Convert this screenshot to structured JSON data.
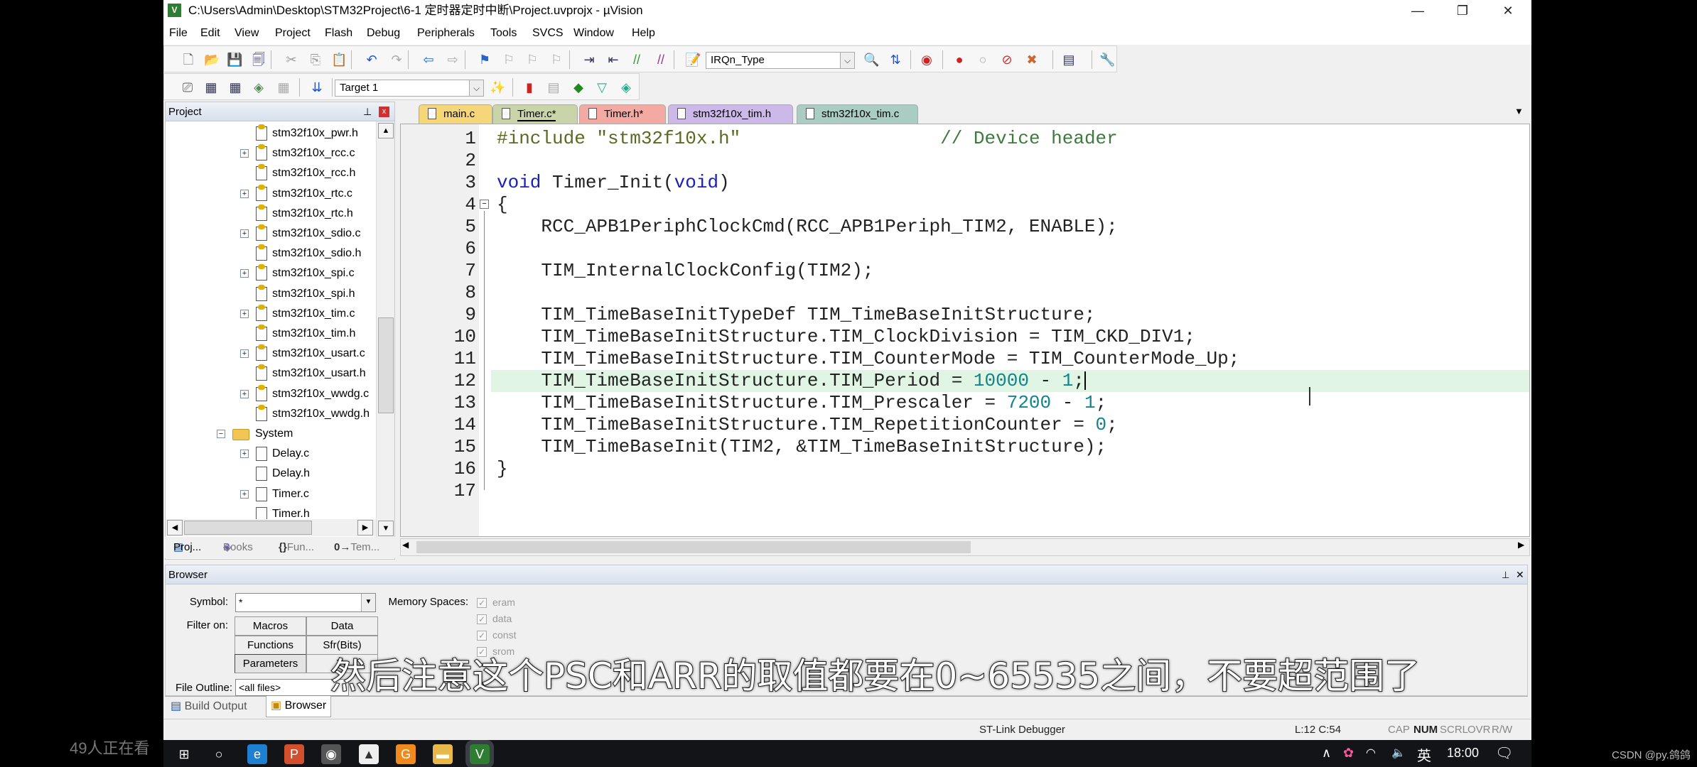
{
  "window": {
    "title": "C:\\Users\\Admin\\Desktop\\STM32Project\\6-1 定时器定时中断\\Project.uvprojx - µVision",
    "app_icon": "keil-uvision-icon",
    "controls": {
      "minimize": "—",
      "restore": "❐",
      "close": "✕"
    }
  },
  "menu": [
    "File",
    "Edit",
    "View",
    "Project",
    "Flash",
    "Debug",
    "Peripherals",
    "Tools",
    "SVCS",
    "Window",
    "Help"
  ],
  "toolbar1": {
    "icons": [
      {
        "name": "new-file-icon",
        "glyph": "🗋",
        "color": "#666"
      },
      {
        "name": "open-file-icon",
        "glyph": "📂",
        "color": "#c80"
      },
      {
        "name": "save-icon",
        "glyph": "💾",
        "color": "#336"
      },
      {
        "name": "save-all-icon",
        "glyph": "🗐",
        "color": "#336"
      },
      {
        "name": "cut-icon",
        "glyph": "✂",
        "color": "#999"
      },
      {
        "name": "copy-icon",
        "glyph": "⎘",
        "color": "#999"
      },
      {
        "name": "paste-icon",
        "glyph": "📋",
        "color": "#a70"
      },
      {
        "name": "undo-icon",
        "glyph": "↶",
        "color": "#2255cc"
      },
      {
        "name": "redo-icon",
        "glyph": "↷",
        "color": "#aaa"
      },
      {
        "name": "navigate-back-icon",
        "glyph": "⇦",
        "color": "#2266cc"
      },
      {
        "name": "navigate-forward-icon",
        "glyph": "⇨",
        "color": "#aaa"
      },
      {
        "name": "bookmark-icon",
        "glyph": "⚑",
        "color": "#2266cc"
      },
      {
        "name": "prev-bookmark-icon",
        "glyph": "⚐",
        "color": "#aaa"
      },
      {
        "name": "next-bookmark-icon",
        "glyph": "⚐",
        "color": "#aaa"
      },
      {
        "name": "clear-bookmarks-icon",
        "glyph": "⚐",
        "color": "#aaa"
      },
      {
        "name": "indent-icon",
        "glyph": "⇥",
        "color": "#335"
      },
      {
        "name": "unindent-icon",
        "glyph": "⇤",
        "color": "#335"
      },
      {
        "name": "comment-icon",
        "glyph": "//",
        "color": "#393"
      },
      {
        "name": "uncomment-icon",
        "glyph": "//",
        "color": "#939"
      },
      {
        "name": "find-in-files-icon",
        "glyph": "📝",
        "color": "#a70"
      }
    ],
    "find_combo": "IRQn_Type",
    "icons2": [
      {
        "name": "find-icon",
        "glyph": "🔍",
        "color": "#336"
      },
      {
        "name": "incremental-find-icon",
        "glyph": "⇅",
        "color": "#2255cc"
      },
      {
        "name": "debug-session-icon",
        "glyph": "◉",
        "color": "#c22"
      },
      {
        "name": "breakpoint-icon",
        "glyph": "●",
        "color": "#c22"
      },
      {
        "name": "disable-breakpoint-icon",
        "glyph": "○",
        "color": "#aaa"
      },
      {
        "name": "disable-all-breakpoints-icon",
        "glyph": "⊘",
        "color": "#c33"
      },
      {
        "name": "kill-breakpoints-icon",
        "glyph": "✖",
        "color": "#c63"
      },
      {
        "name": "window-layout-icon",
        "glyph": "▤",
        "color": "#336"
      },
      {
        "name": "configure-icon",
        "glyph": "🔧",
        "color": "#556"
      }
    ]
  },
  "toolbar2": {
    "icons": [
      {
        "name": "translate-icon",
        "glyph": "⎚",
        "color": "#555"
      },
      {
        "name": "build-icon",
        "glyph": "▦",
        "color": "#335"
      },
      {
        "name": "rebuild-icon",
        "glyph": "▦",
        "color": "#335"
      },
      {
        "name": "batch-build-icon",
        "glyph": "◈",
        "color": "#585"
      },
      {
        "name": "stop-build-icon",
        "glyph": "▦",
        "color": "#aaa"
      },
      {
        "name": "download-load-icon",
        "glyph": "⇊",
        "color": "#2255cc"
      }
    ],
    "target": "Target 1",
    "icons2": [
      {
        "name": "target-options-icon",
        "glyph": "✨",
        "color": "#335"
      },
      {
        "name": "file-extensions-icon",
        "glyph": "▮",
        "color": "#c22"
      },
      {
        "name": "manage-components-icon",
        "glyph": "▤",
        "color": "#aaa"
      },
      {
        "name": "select-pack-icon",
        "glyph": "◆",
        "color": "#282"
      },
      {
        "name": "pack-installer-icon",
        "glyph": "▽",
        "color": "#2a8"
      },
      {
        "name": "run-time-env-icon",
        "glyph": "◈",
        "color": "#2a8"
      }
    ]
  },
  "project": {
    "title": "Project",
    "pin": "⊥",
    "close": "x",
    "tree": [
      {
        "label": "stm32f10x_pwr.h",
        "expand": false,
        "icon": "key-file-icon"
      },
      {
        "label": "stm32f10x_rcc.c",
        "expand": true,
        "icon": "key-file-icon"
      },
      {
        "label": "stm32f10x_rcc.h",
        "expand": false,
        "icon": "key-file-icon"
      },
      {
        "label": "stm32f10x_rtc.c",
        "expand": true,
        "icon": "key-file-icon"
      },
      {
        "label": "stm32f10x_rtc.h",
        "expand": false,
        "icon": "key-file-icon"
      },
      {
        "label": "stm32f10x_sdio.c",
        "expand": true,
        "icon": "key-file-icon"
      },
      {
        "label": "stm32f10x_sdio.h",
        "expand": false,
        "icon": "key-file-icon"
      },
      {
        "label": "stm32f10x_spi.c",
        "expand": true,
        "icon": "key-file-icon"
      },
      {
        "label": "stm32f10x_spi.h",
        "expand": false,
        "icon": "key-file-icon"
      },
      {
        "label": "stm32f10x_tim.c",
        "expand": true,
        "icon": "key-file-icon"
      },
      {
        "label": "stm32f10x_tim.h",
        "expand": false,
        "icon": "key-file-icon"
      },
      {
        "label": "stm32f10x_usart.c",
        "expand": true,
        "icon": "key-file-icon"
      },
      {
        "label": "stm32f10x_usart.h",
        "expand": false,
        "icon": "key-file-icon"
      },
      {
        "label": "stm32f10x_wwdg.c",
        "expand": true,
        "icon": "key-file-icon"
      },
      {
        "label": "stm32f10x_wwdg.h",
        "expand": false,
        "icon": "key-file-icon"
      },
      {
        "label": "System",
        "expand": "collapse",
        "icon": "folder-icon"
      },
      {
        "label": "Delay.c",
        "expand": true,
        "icon": "file-icon"
      },
      {
        "label": "Delay.h",
        "expand": false,
        "icon": "file-icon"
      },
      {
        "label": "Timer.c",
        "expand": true,
        "icon": "file-icon"
      },
      {
        "label": "Timer.h",
        "expand": false,
        "icon": "file-icon"
      }
    ],
    "tabs": [
      "Proj...",
      "Books",
      "Fun...",
      "Tem..."
    ]
  },
  "editor": {
    "tabs": [
      {
        "label": "main.c",
        "color": "#f5d77a"
      },
      {
        "label": "Timer.c*",
        "color": "#c9d5a9",
        "active": true
      },
      {
        "label": "Timer.h*",
        "color": "#f2aaa2"
      },
      {
        "label": "stm32f10x_tim.h",
        "color": "#cdb8ea"
      },
      {
        "label": "stm32f10x_tim.c",
        "color": "#a9cdc2"
      }
    ],
    "tab_menu": "▼",
    "tab_close": "X",
    "current_line": 12,
    "lines": [
      [
        [
          "#include \"stm32f10x.h\"",
          "pp"
        ],
        [
          "                  ",
          ""
        ],
        [
          "// Device header",
          "cm"
        ]
      ],
      [],
      [
        [
          "void",
          "kw"
        ],
        [
          " Timer_Init(",
          ""
        ],
        [
          "void",
          "kw"
        ],
        [
          ")",
          ""
        ]
      ],
      [
        [
          "{",
          ""
        ]
      ],
      [
        [
          "    RCC_APB1PeriphClockCmd(RCC_APB1Periph_TIM2, ENABLE);",
          ""
        ]
      ],
      [],
      [
        [
          "    TIM_InternalClockConfig(TIM2);",
          ""
        ]
      ],
      [],
      [
        [
          "    TIM_TimeBaseInitTypeDef TIM_TimeBaseInitStructure;",
          ""
        ]
      ],
      [
        [
          "    TIM_TimeBaseInitStructure.TIM_ClockDivision = TIM_CKD_DIV1;",
          ""
        ]
      ],
      [
        [
          "    TIM_TimeBaseInitStructure.TIM_CounterMode = TIM_CounterMode_Up;",
          ""
        ]
      ],
      [
        [
          "    TIM_TimeBaseInitStructure.TIM_Period = ",
          ""
        ],
        [
          "10000",
          "num"
        ],
        [
          " - ",
          ""
        ],
        [
          "1",
          "num"
        ],
        [
          ";",
          ""
        ]
      ],
      [
        [
          "    TIM_TimeBaseInitStructure.TIM_Prescaler = ",
          ""
        ],
        [
          "7200",
          "num"
        ],
        [
          " - ",
          ""
        ],
        [
          "1",
          "num"
        ],
        [
          ";",
          ""
        ]
      ],
      [
        [
          "    TIM_TimeBaseInitStructure.TIM_RepetitionCounter = ",
          ""
        ],
        [
          "0",
          "num"
        ],
        [
          ";",
          ""
        ]
      ],
      [
        [
          "    TIM_TimeBaseInit(TIM2, &TIM_TimeBaseInitStructure);",
          ""
        ]
      ],
      [
        [
          "}",
          ""
        ]
      ],
      []
    ]
  },
  "browser": {
    "title": "Browser",
    "symbol_label": "Symbol:",
    "symbol_value": "*",
    "memory_label": "Memory Spaces:",
    "memory_spaces": [
      "eram",
      "data",
      "const",
      "srom"
    ],
    "filter_label": "Filter on:",
    "filters": [
      "Macros",
      "Data",
      "Functions",
      "Sfr(Bits)",
      "Parameters",
      "Ty"
    ],
    "file_outline_label": "File Outline:",
    "file_outline_value": "<all files>"
  },
  "bottom_tabs": [
    "Build Output",
    "Browser"
  ],
  "status": {
    "debugger": "ST-Link Debugger",
    "position": "L:12 C:54",
    "cap": "CAP",
    "num": "NUM",
    "scrl": "SCRL",
    "ovr": "OVR",
    "rw": "R/W"
  },
  "taskbar": {
    "apps": [
      {
        "name": "start-icon",
        "glyph": "⊞",
        "bg": "transparent"
      },
      {
        "name": "cortana-icon",
        "glyph": "○",
        "bg": "transparent"
      },
      {
        "name": "edge-icon",
        "glyph": "e",
        "bg": "#1f7fd0"
      },
      {
        "name": "powerpoint-icon",
        "glyph": "P",
        "bg": "#d2502d"
      },
      {
        "name": "camera-icon",
        "glyph": "◉",
        "bg": "#555"
      },
      {
        "name": "photos-icon",
        "glyph": "▲",
        "bg": "#eee"
      },
      {
        "name": "foxit-icon",
        "glyph": "G",
        "bg": "#f08a1c"
      },
      {
        "name": "file-explorer-icon",
        "glyph": "▬",
        "bg": "#e8b84a"
      },
      {
        "name": "keil-icon",
        "glyph": "V",
        "bg": "#2e7d32"
      }
    ],
    "tray_chevron": "∧",
    "ime": "英",
    "time": "18:00",
    "notification": "🗨"
  },
  "overlay": {
    "subtitle": "然后注意这个PSC和ARR的取值都要在0~65535之间，不要超范围了",
    "viewers": "49人正在看",
    "watermark": "CSDN @py.鸽鸽"
  }
}
